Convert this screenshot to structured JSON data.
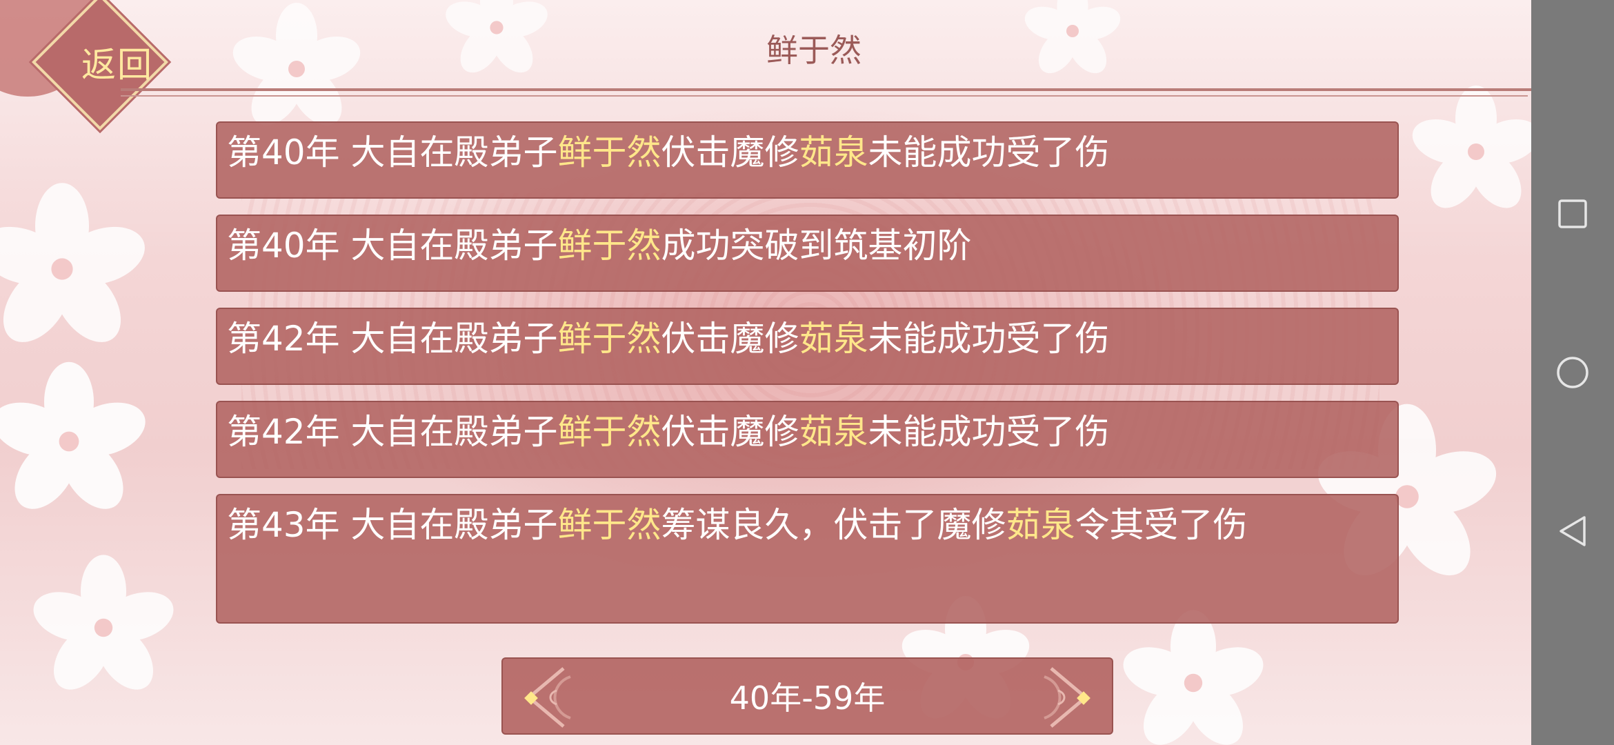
{
  "header": {
    "back_label": "返回",
    "title": "鲜于然"
  },
  "entries": [
    {
      "year": "第40年",
      "parts": [
        {
          "t": " 大自在殿弟子"
        },
        {
          "t": "鲜于然",
          "hl": true
        },
        {
          "t": "伏击魔修"
        },
        {
          "t": "茹泉",
          "hl": true
        },
        {
          "t": "未能成功受了伤"
        }
      ]
    },
    {
      "year": "第40年",
      "parts": [
        {
          "t": " 大自在殿弟子"
        },
        {
          "t": "鲜于然",
          "hl": true
        },
        {
          "t": "成功突破到筑基初阶"
        }
      ]
    },
    {
      "year": "第42年",
      "parts": [
        {
          "t": " 大自在殿弟子"
        },
        {
          "t": "鲜于然",
          "hl": true
        },
        {
          "t": "伏击魔修"
        },
        {
          "t": "茹泉",
          "hl": true
        },
        {
          "t": "未能成功受了伤"
        }
      ]
    },
    {
      "year": "第42年",
      "parts": [
        {
          "t": " 大自在殿弟子"
        },
        {
          "t": "鲜于然",
          "hl": true
        },
        {
          "t": "伏击魔修"
        },
        {
          "t": "茹泉",
          "hl": true
        },
        {
          "t": "未能成功受了伤"
        }
      ]
    },
    {
      "year": "第43年",
      "parts": [
        {
          "t": " 大自在殿弟子"
        },
        {
          "t": "鲜于然",
          "hl": true
        },
        {
          "t": "筹谋良久，伏击了魔修"
        },
        {
          "t": "茹泉",
          "hl": true
        },
        {
          "t": "令其受了伤"
        }
      ]
    }
  ],
  "pager": {
    "label": "40年-59年",
    "prev_icon": "ornate-arrow-left-icon",
    "next_icon": "ornate-arrow-right-icon"
  },
  "navbar": {
    "icons": [
      "recent-apps-icon",
      "home-icon",
      "back-icon"
    ]
  },
  "colors": {
    "entry_bg": "#b26462",
    "highlight": "#ffe78a",
    "title": "#9b5a58",
    "back_label": "#ffe9a0"
  }
}
